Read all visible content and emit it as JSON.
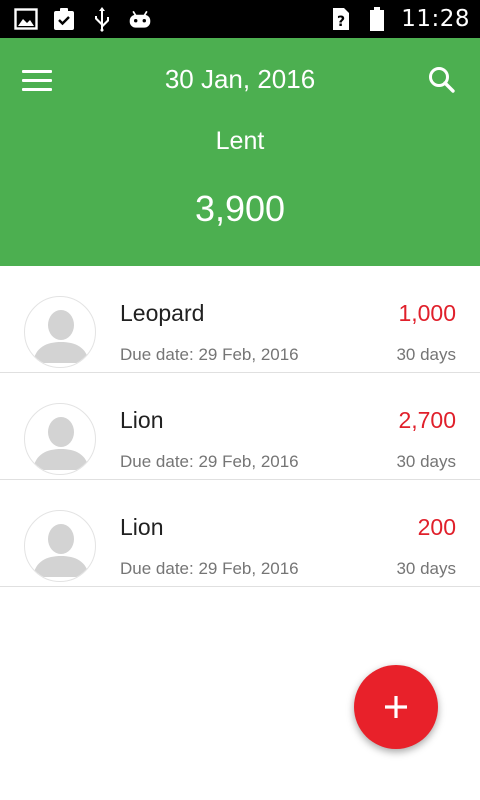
{
  "status_bar": {
    "time": "11:28",
    "icons_left": [
      "image-icon",
      "clipboard-check-icon",
      "usb-icon",
      "android-icon"
    ],
    "icons_right": [
      "sim-unknown-icon",
      "battery-icon"
    ]
  },
  "header": {
    "date": "30 Jan, 2016",
    "label": "Lent",
    "total": "3,900",
    "background_color": "#4caf50"
  },
  "list": {
    "items": [
      {
        "name": "Leopard",
        "due": "Due date: 29 Feb, 2016",
        "amount": "1,000",
        "days": "30 days"
      },
      {
        "name": "Lion",
        "due": "Due date: 29 Feb, 2016",
        "amount": "2,700",
        "days": "30 days"
      },
      {
        "name": "Lion",
        "due": "Due date: 29 Feb, 2016",
        "amount": "200",
        "days": "30 days"
      }
    ],
    "amount_color": "#e0202b"
  },
  "fab": {
    "icon": "plus-icon",
    "color": "#e8212a"
  }
}
